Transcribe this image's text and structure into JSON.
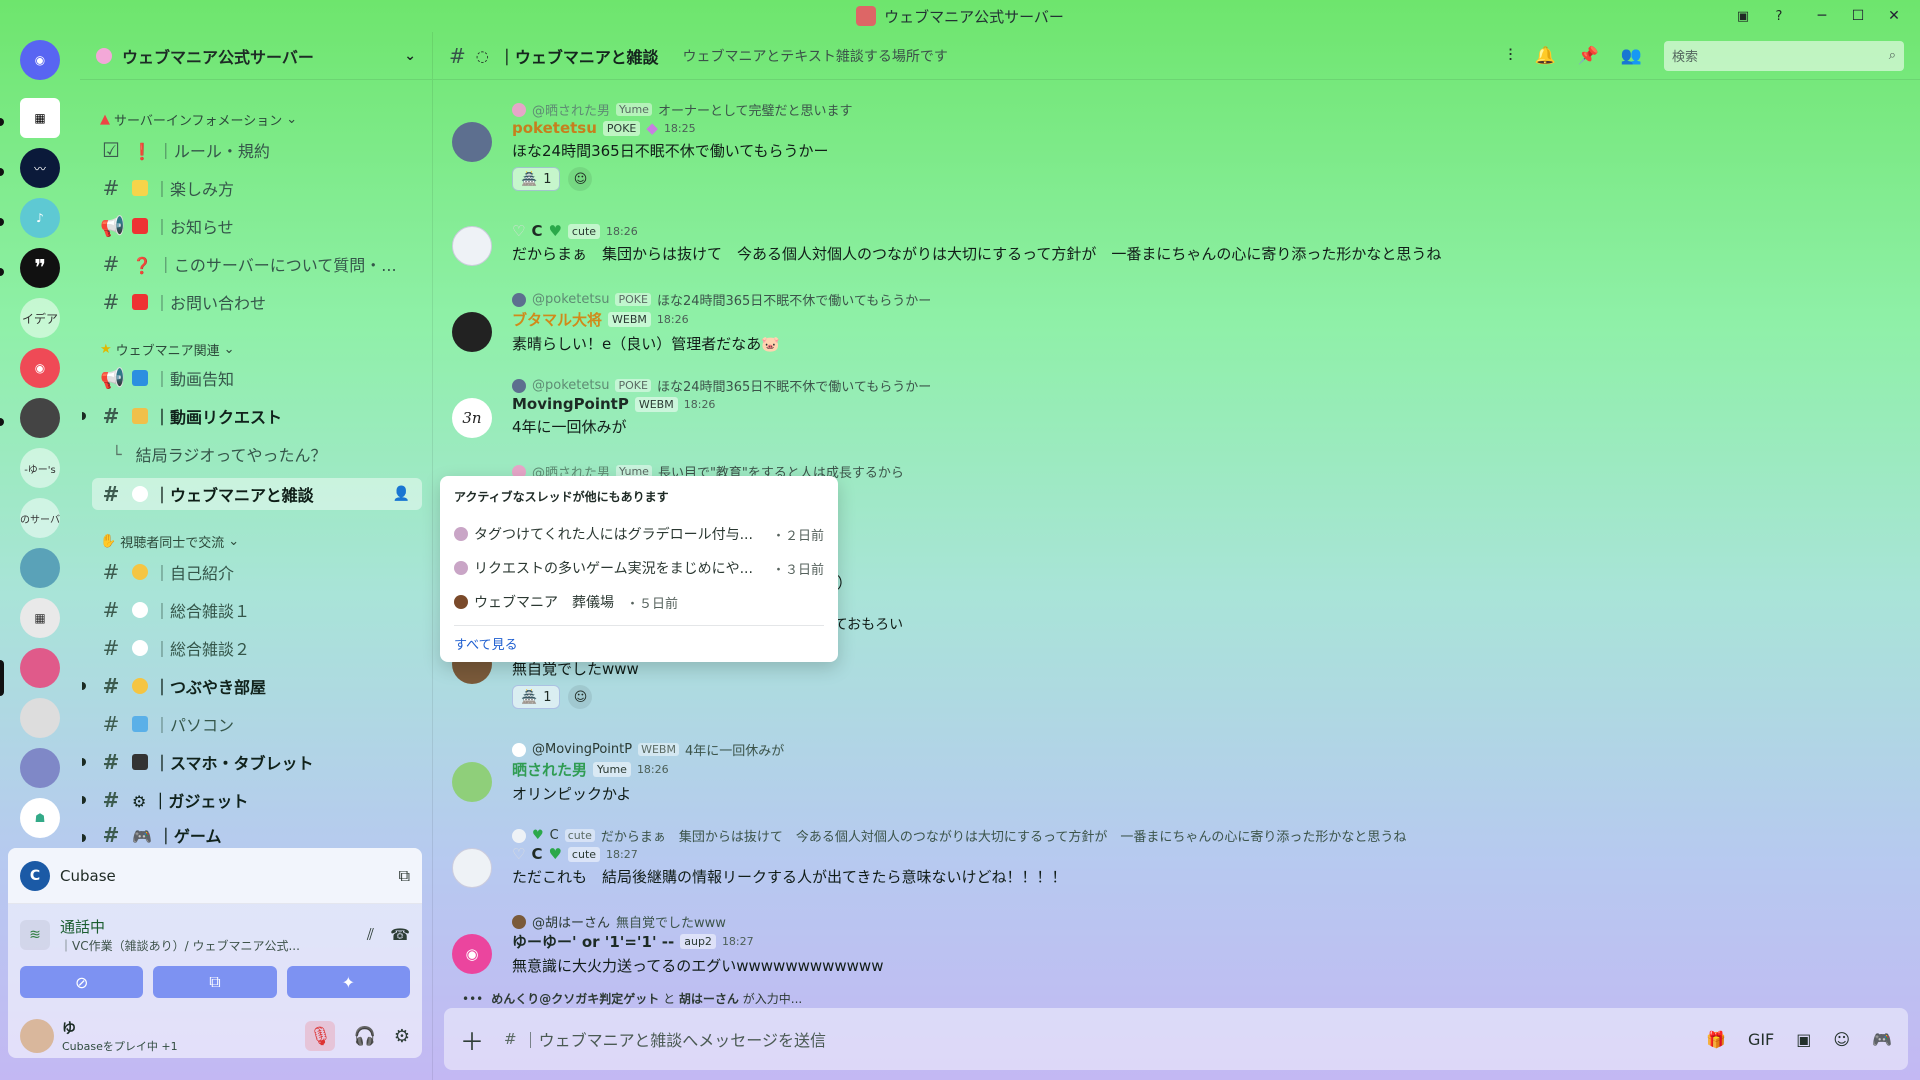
{
  "window": {
    "title": "ウェブマニア公式サーバー"
  },
  "server": {
    "name": "ウェブマニア公式サーバー"
  },
  "rail": {
    "idea_label": "イデア",
    "server_a": "-ゆー's",
    "server_b": "のサーバ"
  },
  "categories": {
    "info": "サーバーインフォメーション",
    "related": "ウェブマニア関連",
    "viewers": "視聴者同士で交流"
  },
  "channels": {
    "rules": "｜ルール・規約",
    "howto": "｜楽しみ方",
    "news": "｜お知らせ",
    "about": "｜このサーバーについて質問・...",
    "contact": "｜お問い合わせ",
    "video_notice": "｜動画告知",
    "video_request": "｜動画リクエスト",
    "thread_radio": "結局ラジオってやったん？",
    "webmania_chat": "｜ウェブマニアと雑談",
    "intro": "｜自己紹介",
    "chat1": "｜総合雑談１",
    "chat2": "｜総合雑談２",
    "tsubuyaki": "｜つぶやき部屋",
    "pc": "｜パソコン",
    "phone": "｜スマホ・タブレット",
    "gadget": "｜ガジェット",
    "game": "｜ゲーム"
  },
  "voice": {
    "app_name": "Cubase",
    "status": "通話中",
    "channel": "｜VC作業（雑談あり）/ ウェブマニア公式..."
  },
  "user": {
    "name": "ゆ",
    "status": "Cubaseをプレイ中 +1"
  },
  "header": {
    "channel": "｜ウェブマニアと雑談",
    "topic": "ウェブマニアとテキスト雑談する場所です",
    "search_placeholder": "検索"
  },
  "messages": [
    {
      "reply_name": "@晒された男",
      "reply_tag": "Yume",
      "reply_text": "オーナーとして完璧だと思います",
      "name": "poketetsu",
      "tag": "POKE",
      "time": "18:25",
      "text": "ほな24時間365日不眠不休で働いてもらうかー",
      "react_count": "1"
    },
    {
      "name": "C",
      "tag": "cute",
      "time": "18:26",
      "text": "だからまぁ　集団からは抜けて　今ある個人対個人のつながりは大切にするって方針が　一番まにちゃんの心に寄り添った形かなと思うね"
    },
    {
      "reply_name": "@poketetsu",
      "reply_tag": "POKE",
      "reply_text": "ほな24時間365日不眠不休で働いてもらうかー",
      "name": "ブタマル大将",
      "tag": "WEBM",
      "time": "18:26",
      "text": "素晴らしい！e（良い）管理者だなあ🐷"
    },
    {
      "reply_name": "@poketetsu",
      "reply_tag": "POKE",
      "reply_text": "ほな24時間365日不眠不休で働いてもらうかー",
      "name": "MovingPointP",
      "tag": "WEBM",
      "time": "18:26",
      "text": "4年に一回休みが"
    },
    {
      "reply_name": "@晒された男",
      "reply_tag": "Yume",
      "reply_text": "長い目で\"教育\"をすると人は成長するから"
    },
    {
      "text_partial_a": "すよ（）",
      "text_partial_b": "カ強くておもろい",
      "text": "無自覚でしたwww",
      "react_count": "1"
    },
    {
      "reply_name": "@MovingPointP",
      "reply_tag": "WEBM",
      "reply_text": "4年に一回休みが",
      "name": "晒された男",
      "tag": "Yume",
      "time": "18:26",
      "text": "オリンピックかよ"
    },
    {
      "reply_name": "C",
      "reply_tag": "cute",
      "reply_text": "だからまぁ　集団からは抜けて　今ある個人対個人のつながりは大切にするって方針が　一番まにちゃんの心に寄り添った形かなと思うね",
      "name": "C",
      "tag": "cute",
      "time": "18:27",
      "text": "ただこれも　結局後継購の情報リークする人が出てきたら意味ないけどね！！！！"
    },
    {
      "reply_name": "@胡はーさん",
      "reply_text": "無自覚でしたwww",
      "name": "ゆーゆー' or '1'='1' --",
      "tag": "aup2",
      "time": "18:27",
      "text": "無意識に大火力送ってるのエグいwwwwwwwwwwww"
    }
  ],
  "threads_popup": {
    "title": "アクティブなスレッドが他にもあります",
    "items": [
      {
        "name": "タグつけてくれた人にはグラデロール付与...",
        "ago": "・２日前"
      },
      {
        "name": "リクエストの多いゲーム実況をまじめにや...",
        "ago": "・３日前"
      },
      {
        "name": "ウェブマニア　葬儀場",
        "ago": "・５日前"
      }
    ],
    "see_all": "すべて見る"
  },
  "typing": {
    "users": "めんくり@クソガキ判定ゲット",
    "and": "と",
    "user2": "胡はーさん",
    "suffix": "が入力中..."
  },
  "composer": {
    "placeholder": "｜ウェブマニアと雑談へメッセージを送信"
  }
}
